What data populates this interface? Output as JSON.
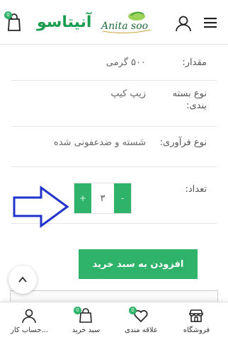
{
  "header": {
    "title": "آنیتاسو",
    "logo_text": "Anita soo",
    "cart_count": "0"
  },
  "specs": [
    {
      "label": "مقدار:",
      "value": "۵۰۰ گرمی"
    },
    {
      "label": "نوع بسته بندی:",
      "value": "زیپ کیپ"
    },
    {
      "label": "نوع فرآوری:",
      "value": "شسته و ضدعفونی شده"
    }
  ],
  "quantity": {
    "label": "تعداد:",
    "value": "۳",
    "plus": "+",
    "minus": "-"
  },
  "add_to_cart": "افزودن به سبد خرید",
  "bottom_nav": {
    "shop": "فروشگاه",
    "wishlist": "علاقه مندی",
    "wishlist_count": "0",
    "cart": "سبد خرید",
    "cart_count": "0",
    "account": "حساب کار..."
  },
  "colors": {
    "accent": "#2fb36a",
    "annotation_arrow": "#2233cc"
  }
}
